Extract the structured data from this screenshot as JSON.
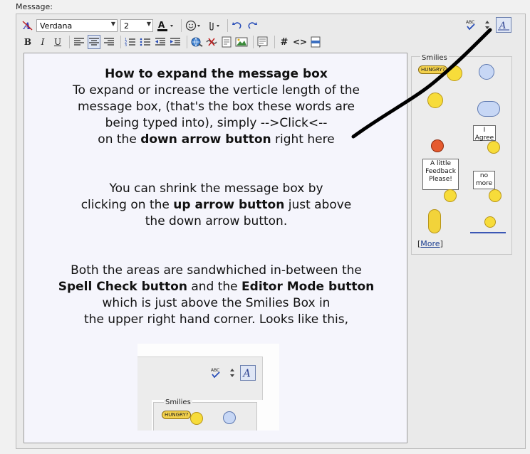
{
  "label": "Message:",
  "toolbar": {
    "font_name": "Verdana",
    "font_size": "2",
    "format_buttons": [
      "B",
      "I",
      "U"
    ],
    "insert_hash": "#",
    "insert_code": "<>"
  },
  "message": {
    "heading": "How to expand the message box",
    "p1_line1": "To expand or increase the verticle length of the",
    "p1_line2": "message box, (that's the box these words are",
    "p1_line3": "being typed into), simply -->Click<--",
    "p1_line4_pre": "on the ",
    "p1_line4_bold": "down arrow button",
    "p1_line4_post": " right here",
    "p2_line1": "You can shrink the message box by",
    "p2_line2_pre": "clicking on the ",
    "p2_line2_bold": "up arrow button",
    "p2_line2_post": " just above",
    "p2_line3": "the down arrow button.",
    "p3_line1": "Both the areas are sandwhiched in-between the",
    "p3_line2_bold1": "Spell Check button",
    "p3_line2_mid": " and the ",
    "p3_line2_bold2": "Editor Mode button",
    "p3_line3": "which is just above the Smilies Box in",
    "p3_line4": "the upper right hand corner.  Looks like this,"
  },
  "smilies": {
    "title": "Smilies",
    "hungry": "HUNGRY?",
    "agree": "I Agree",
    "feedback": "A little Feedback Please!",
    "nomore": "no more",
    "more_label": "More",
    "more_open": "[",
    "more_close": "]"
  },
  "inset": {
    "smilies_title": "Smilies",
    "hungry": "HUNGRY?"
  },
  "colors": {
    "annotation_line": "#000000",
    "editor_bg": "#f5f5fc",
    "link": "#1a3d8f"
  }
}
